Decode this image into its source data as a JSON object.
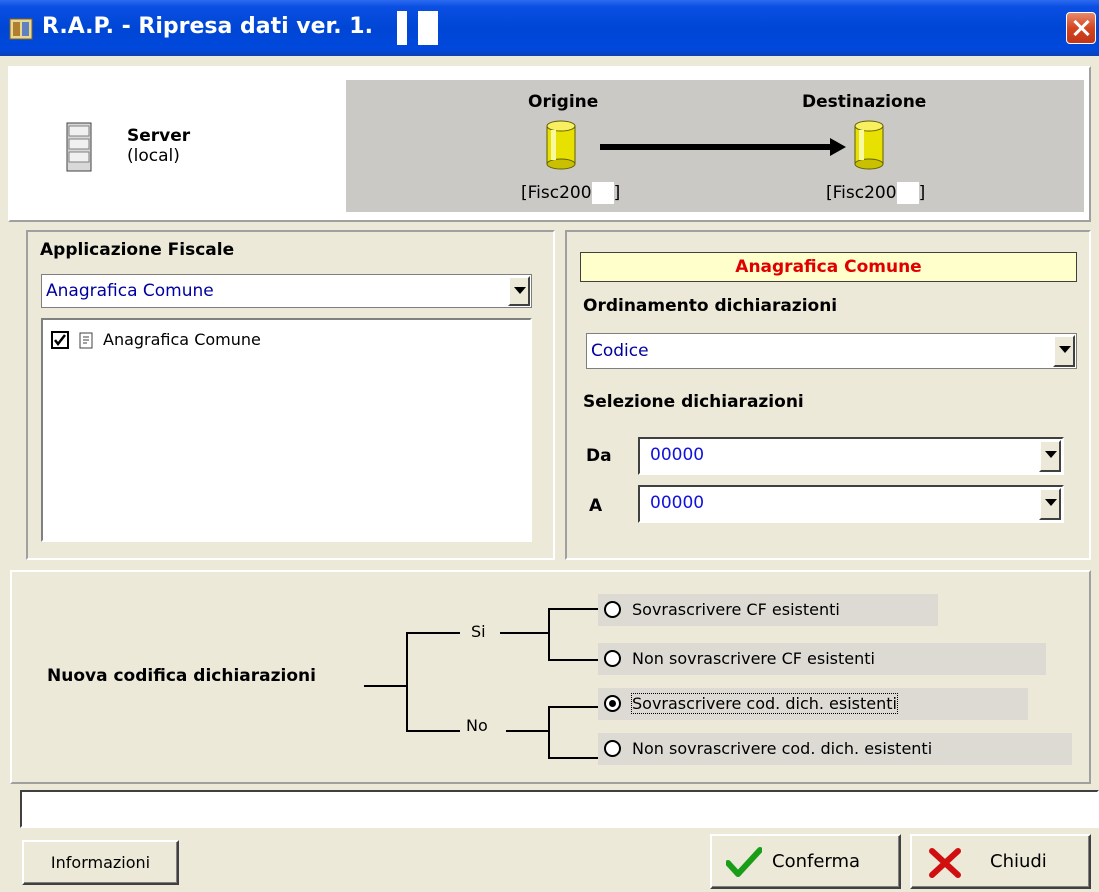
{
  "window": {
    "title": "R.A.P. - Ripresa dati ver. 1."
  },
  "server": {
    "name": "Server",
    "instance": "(local)"
  },
  "transfer": {
    "origin_label": "Origine",
    "destination_label": "Destinazione",
    "origin_db": "[Fisc200",
    "origin_db_end": "]",
    "destination_db": "[Fisc200",
    "destination_db_end": "]"
  },
  "app_panel": {
    "heading": "Applicazione Fiscale",
    "selected_app": "Anagrafica Comune",
    "list_items": [
      {
        "label": "Anagrafica Comune",
        "checked": true
      }
    ]
  },
  "right_panel": {
    "banner": "Anagrafica Comune",
    "sort_heading": "Ordinamento dichiarazioni",
    "sort_value": "Codice",
    "selection_heading": "Selezione dichiarazioni",
    "from_label": "Da",
    "from_value": "00000",
    "to_label": "A",
    "to_value": "00000"
  },
  "coding": {
    "heading": "Nuova codifica dichiarazioni",
    "yes_label": "Si",
    "no_label": "No",
    "options": [
      {
        "label": "Sovrascrivere CF esistenti",
        "selected": false
      },
      {
        "label": "Non sovrascrivere CF esistenti",
        "selected": false
      },
      {
        "label": "Sovrascrivere cod. dich. esistenti",
        "selected": true
      },
      {
        "label": "Non sovrascrivere cod. dich. esistenti",
        "selected": false
      }
    ]
  },
  "status_bar": {
    "text": ""
  },
  "buttons": {
    "info": "Informazioni",
    "confirm": "Conferma",
    "close": "Chiudi"
  },
  "colors": {
    "title_bar": "#0046d5",
    "banner_bg": "#ffffcc",
    "banner_text": "#e00000",
    "combo_text": "#0000a0",
    "confirm_icon": "#1a9e1a",
    "close_icon": "#d01010"
  }
}
